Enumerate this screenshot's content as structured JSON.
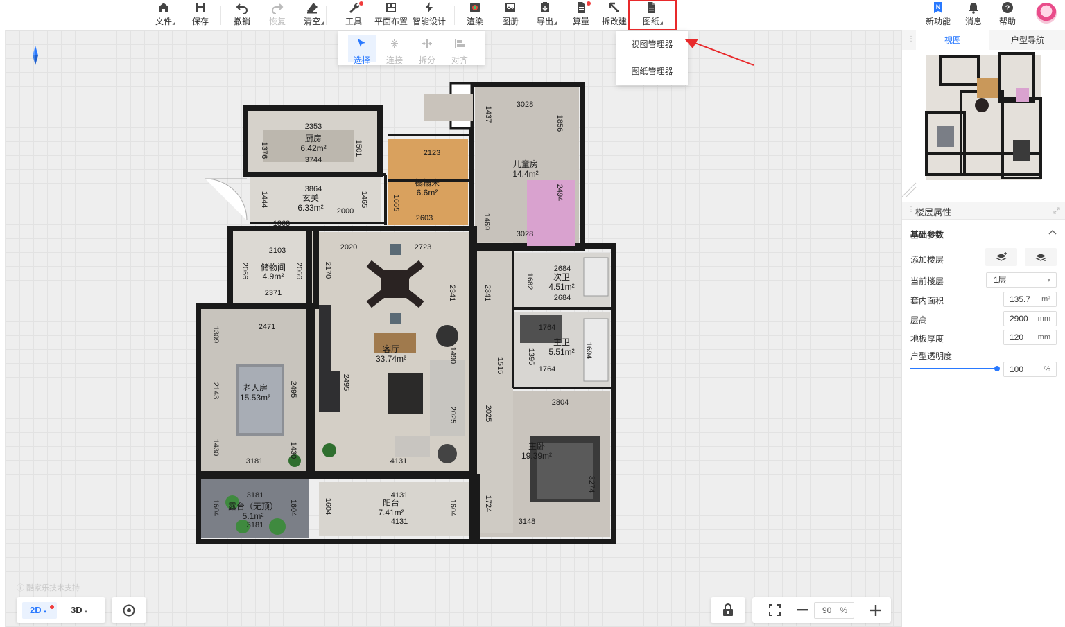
{
  "toolbar": {
    "items": [
      {
        "label": "文件",
        "icon": "home-icon",
        "caret": true
      },
      {
        "label": "保存",
        "icon": "save-icon"
      },
      {
        "label": "撤销",
        "icon": "undo-icon"
      },
      {
        "label": "恢复",
        "icon": "redo-icon",
        "disabled": true
      },
      {
        "label": "清空",
        "icon": "eraser-icon",
        "caret": true
      },
      {
        "label": "工具",
        "icon": "wrench-icon",
        "dot": true
      },
      {
        "label": "平面布置",
        "icon": "layout-icon"
      },
      {
        "label": "智能设计",
        "icon": "lightning-icon"
      },
      {
        "label": "渲染",
        "icon": "render-icon"
      },
      {
        "label": "图册",
        "icon": "album-icon"
      },
      {
        "label": "导出",
        "icon": "export-icon",
        "caret": true
      },
      {
        "label": "算量",
        "icon": "calculate-icon",
        "dot": true
      },
      {
        "label": "拆改建",
        "icon": "demolish-icon"
      },
      {
        "label": "图纸",
        "icon": "drawing-icon",
        "caret": true
      }
    ],
    "right": [
      {
        "label": "新功能",
        "icon": "new-feature-icon",
        "badge": "N"
      },
      {
        "label": "消息",
        "icon": "bell-icon"
      },
      {
        "label": "帮助",
        "icon": "help-icon"
      }
    ]
  },
  "subbar": {
    "items": [
      {
        "label": "选择",
        "icon": "cursor-icon",
        "active": true
      },
      {
        "label": "连接",
        "icon": "connect-icon"
      },
      {
        "label": "拆分",
        "icon": "split-icon"
      },
      {
        "label": "对齐",
        "icon": "align-icon"
      }
    ]
  },
  "dropdown": {
    "items": [
      "视图管理器",
      "图纸管理器"
    ]
  },
  "rooms": [
    {
      "name": "厨房",
      "area": "6.42m²"
    },
    {
      "name": "玄关",
      "area": "6.33m²"
    },
    {
      "name": "榻榻米",
      "area": "6.6m²"
    },
    {
      "name": "儿童房",
      "area": "14.4m²"
    },
    {
      "name": "储物间",
      "area": "4.9m²"
    },
    {
      "name": "客厅",
      "area": "33.74m²"
    },
    {
      "name": "次卫",
      "area": "4.51m²"
    },
    {
      "name": "主卫",
      "area": "5.51m²"
    },
    {
      "name": "老人房",
      "area": "15.53m²"
    },
    {
      "name": "主卧",
      "area": "19.39m²"
    },
    {
      "name": "露台（无顶）",
      "area": "5.1m²"
    },
    {
      "name": "阳台",
      "area": "7.41m²"
    }
  ],
  "dimensions": [
    "2353",
    "3744",
    "1376",
    "1501",
    "3864",
    "1444",
    "1465",
    "2000",
    "1863",
    "2123",
    "1665",
    "2603",
    "3028",
    "1437",
    "1856",
    "2494",
    "1469",
    "3028",
    "2103",
    "2066",
    "2066",
    "2371",
    "2020",
    "2723",
    "2170",
    "2341",
    "2341",
    "1682",
    "2684",
    "2684",
    "2471",
    "1309",
    "2143",
    "2495",
    "1430",
    "1430",
    "3181",
    "2495",
    "1490",
    "2025",
    "4131",
    "1764",
    "1395",
    "1694",
    "1764",
    "1515",
    "2804",
    "2025",
    "3274",
    "3181",
    "1604",
    "1604",
    "3181",
    "4131",
    "1604",
    "1604",
    "4131",
    "1724",
    "3148"
  ],
  "right_panel": {
    "tabs": [
      "视图",
      "户型导航"
    ],
    "active_tab": 0,
    "props_title": "楼层属性",
    "section": "基础参数",
    "add_floor_label": "添加楼层",
    "current_floor_label": "当前楼层",
    "current_floor_value": "1层",
    "fields": [
      {
        "label": "套内面积",
        "value": "135.7",
        "unit": "m²"
      },
      {
        "label": "层高",
        "value": "2900",
        "unit": "mm"
      },
      {
        "label": "地板厚度",
        "value": "120",
        "unit": "mm"
      }
    ],
    "opacity_label": "户型透明度",
    "opacity_value": "100",
    "opacity_unit": "%"
  },
  "bottom": {
    "mode_2d": "2D",
    "mode_3d": "3D",
    "zoom_value": "90",
    "zoom_unit": "%",
    "watermark": "酷家乐技术支持"
  },
  "colors": {
    "accent": "#2979ff",
    "highlight": "#e8292b",
    "dot": "#f03c3c"
  }
}
